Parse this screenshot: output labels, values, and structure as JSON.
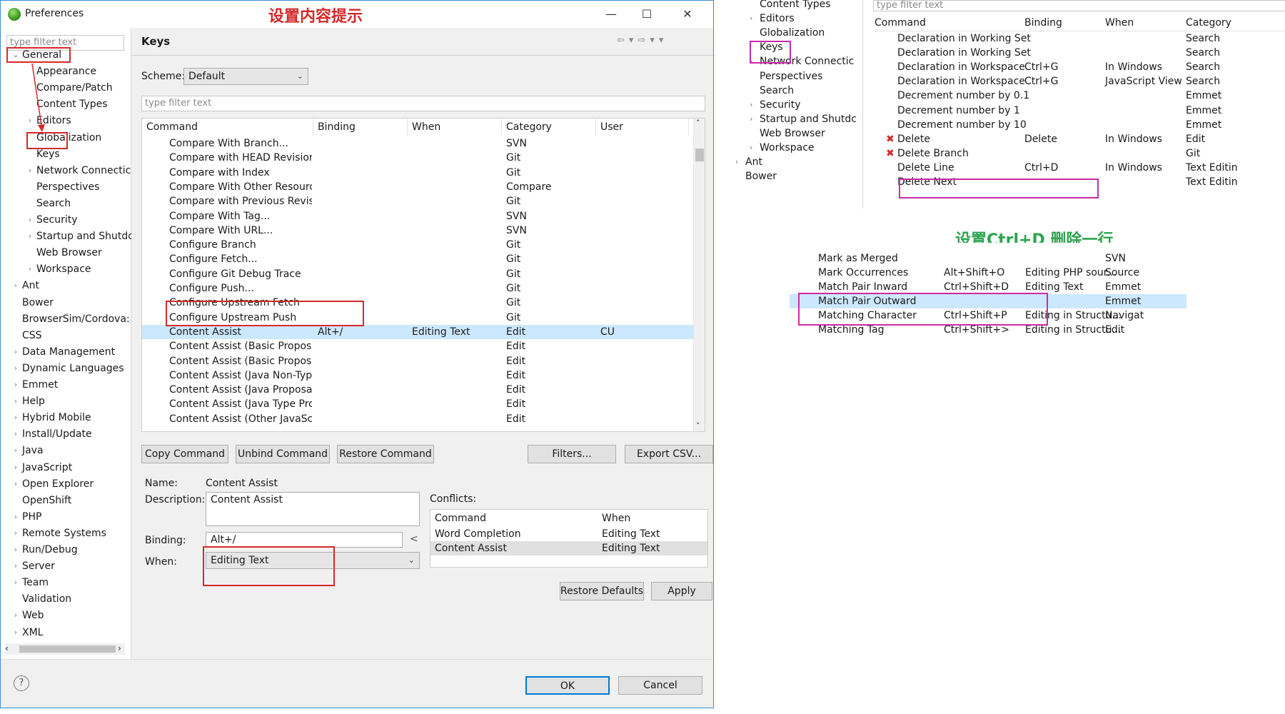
{
  "window": {
    "title": "Preferences",
    "minimize": "—",
    "maximize": "☐",
    "close": "✕",
    "help": "?"
  },
  "annotations": {
    "top_red": "设置内容提示",
    "right_green": "设置Ctrl+D 删除一行"
  },
  "left": {
    "filter_placeholder": "type filter text",
    "items": [
      {
        "label": "General",
        "arrow": "⌄"
      },
      {
        "label": "Appearance",
        "arrow": ""
      },
      {
        "label": "Compare/Patch",
        "arrow": ""
      },
      {
        "label": "Content Types",
        "arrow": ""
      },
      {
        "label": "Editors",
        "arrow": "›"
      },
      {
        "label": "Globalization",
        "arrow": ""
      },
      {
        "label": "Keys",
        "arrow": ""
      },
      {
        "label": "Network Connectic",
        "arrow": "›"
      },
      {
        "label": "Perspectives",
        "arrow": ""
      },
      {
        "label": "Search",
        "arrow": ""
      },
      {
        "label": "Security",
        "arrow": "›"
      },
      {
        "label": "Startup and Shutdc",
        "arrow": "›"
      },
      {
        "label": "Web Browser",
        "arrow": ""
      },
      {
        "label": "Workspace",
        "arrow": "›"
      },
      {
        "label": "Ant",
        "arrow": "›"
      },
      {
        "label": "Bower",
        "arrow": ""
      },
      {
        "label": "BrowserSim/Cordova:",
        "arrow": ""
      },
      {
        "label": "CSS",
        "arrow": ""
      },
      {
        "label": "Data Management",
        "arrow": "›"
      },
      {
        "label": "Dynamic Languages",
        "arrow": "›"
      },
      {
        "label": "Emmet",
        "arrow": "›"
      },
      {
        "label": "Help",
        "arrow": "›"
      },
      {
        "label": "Hybrid Mobile",
        "arrow": "›"
      },
      {
        "label": "Install/Update",
        "arrow": "›"
      },
      {
        "label": "Java",
        "arrow": "›"
      },
      {
        "label": "JavaScript",
        "arrow": "›"
      },
      {
        "label": "Open Explorer",
        "arrow": "›"
      },
      {
        "label": "OpenShift",
        "arrow": ""
      },
      {
        "label": "PHP",
        "arrow": "›"
      },
      {
        "label": "Remote Systems",
        "arrow": "›"
      },
      {
        "label": "Run/Debug",
        "arrow": "›"
      },
      {
        "label": "Server",
        "arrow": "›"
      },
      {
        "label": "Team",
        "arrow": "›"
      },
      {
        "label": "Validation",
        "arrow": ""
      },
      {
        "label": "Web",
        "arrow": "›"
      },
      {
        "label": "XML",
        "arrow": "›"
      }
    ]
  },
  "keys": {
    "title": "Keys",
    "scheme_label": "Scheme:",
    "scheme_value": "Default",
    "filter_placeholder": "type filter text",
    "columns": [
      "Command",
      "Binding",
      "When",
      "Category",
      "User"
    ],
    "rows": [
      [
        "Compare With Branch...",
        "",
        "",
        "SVN",
        ""
      ],
      [
        "Compare with HEAD Revision",
        "",
        "",
        "Git",
        ""
      ],
      [
        "Compare with Index",
        "",
        "",
        "Git",
        ""
      ],
      [
        "Compare With Other Resource",
        "",
        "",
        "Compare",
        ""
      ],
      [
        "Compare with Previous Revisi",
        "",
        "",
        "Git",
        ""
      ],
      [
        "Compare With Tag...",
        "",
        "",
        "SVN",
        ""
      ],
      [
        "Compare With URL...",
        "",
        "",
        "SVN",
        ""
      ],
      [
        "Configure Branch",
        "",
        "",
        "Git",
        ""
      ],
      [
        "Configure Fetch...",
        "",
        "",
        "Git",
        ""
      ],
      [
        "Configure Git Debug Trace",
        "",
        "",
        "Git",
        ""
      ],
      [
        "Configure Push...",
        "",
        "",
        "Git",
        ""
      ],
      [
        "Configure Upstream Fetch",
        "",
        "",
        "Git",
        ""
      ],
      [
        "Configure Upstream Push",
        "",
        "",
        "Git",
        ""
      ],
      [
        "Content Assist",
        "Alt+/",
        "Editing Text",
        "Edit",
        "CU"
      ],
      [
        "Content Assist (Basic Proposal",
        "",
        "",
        "Edit",
        ""
      ],
      [
        "Content Assist (Basic Proposal",
        "",
        "",
        "Edit",
        ""
      ],
      [
        "Content Assist (Java Non-Type",
        "",
        "",
        "Edit",
        ""
      ],
      [
        "Content Assist (Java Proposals",
        "",
        "",
        "Edit",
        ""
      ],
      [
        "Content Assist (Java Type Prop",
        "",
        "",
        "Edit",
        ""
      ],
      [
        "Content Assist (Other JavaScri",
        "",
        "",
        "Edit",
        ""
      ]
    ],
    "buttons": {
      "copy": "Copy Command",
      "unbind": "Unbind Command",
      "restore": "Restore Command",
      "filters": "Filters...",
      "export": "Export CSV..."
    },
    "name_label": "Name:",
    "name_value": "Content Assist",
    "desc_label": "Description:",
    "desc_value": "Content Assist",
    "binding_label": "Binding:",
    "binding_value": "Alt+/",
    "binding_btn": "<",
    "when_label": "When:",
    "when_value": "Editing Text",
    "conflicts_label": "Conflicts:",
    "conflict_columns": [
      "Command",
      "When"
    ],
    "conflicts": [
      [
        "Word Completion",
        "Editing Text"
      ],
      [
        "Content Assist",
        "Editing Text"
      ]
    ],
    "restore_defaults": "Restore Defaults",
    "apply": "Apply",
    "ok": "OK",
    "cancel": "Cancel"
  },
  "snippet1": {
    "tree": [
      "Content Types",
      "Editors",
      "Globalization",
      "Keys",
      "Network Connectic",
      "Perspectives",
      "Search",
      "Security",
      "Startup and Shutdc",
      "Web Browser",
      "Workspace",
      "Ant",
      "Bower"
    ],
    "filter_placeholder": "type filter text",
    "columns": [
      "Command",
      "Binding",
      "When",
      "Category"
    ],
    "rows": [
      [
        "",
        "Declaration in Working Set",
        "",
        "",
        "Search"
      ],
      [
        "",
        "Declaration in Working Set",
        "",
        "",
        "Search"
      ],
      [
        "",
        "Declaration in Workspace",
        "Ctrl+G",
        "In Windows",
        "Search"
      ],
      [
        "",
        "Declaration in Workspace",
        "Ctrl+G",
        "JavaScript View",
        "Search"
      ],
      [
        "",
        "Decrement number by 0.1",
        "",
        "",
        "Emmet"
      ],
      [
        "",
        "Decrement number by 1",
        "",
        "",
        "Emmet"
      ],
      [
        "",
        "Decrement number by 10",
        "",
        "",
        "Emmet"
      ],
      [
        "✖",
        "Delete",
        "Delete",
        "In Windows",
        "Edit"
      ],
      [
        "✖",
        "Delete Branch",
        "",
        "",
        "Git"
      ],
      [
        "",
        "Delete Line",
        "Ctrl+D",
        "In Windows",
        "Text Editin"
      ],
      [
        "",
        "Delete Next",
        "",
        "",
        "Text Editin"
      ]
    ]
  },
  "snippet2": {
    "rows": [
      [
        "Mark as Merged",
        "",
        "",
        "SVN"
      ],
      [
        "Mark Occurrences",
        "Alt+Shift+O",
        "Editing PHP sour...",
        "Source"
      ],
      [
        "Match Pair Inward",
        "Ctrl+Shift+D",
        "Editing Text",
        "Emmet"
      ],
      [
        "Match Pair Outward",
        "",
        "",
        "Emmet"
      ],
      [
        "Matching Character",
        "Ctrl+Shift+P",
        "Editing in Structu...",
        "Navigat"
      ],
      [
        "Matching Tag",
        "Ctrl+Shift+>",
        "Editing in Structu...",
        "Edit"
      ]
    ]
  }
}
